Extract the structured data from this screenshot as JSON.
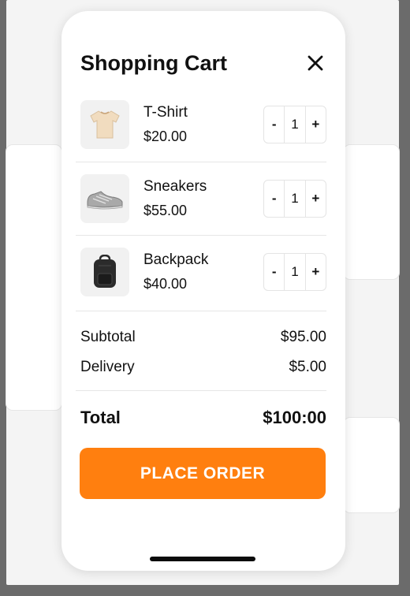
{
  "header": {
    "title": "Shopping Cart"
  },
  "cart": {
    "items": [
      {
        "name": "T-Shirt",
        "price": "$20.00",
        "quantity": "1",
        "image_icon": "tshirt-icon"
      },
      {
        "name": "Sneakers",
        "price": "$55.00",
        "quantity": "1",
        "image_icon": "sneaker-icon"
      },
      {
        "name": "Backpack",
        "price": "$40.00",
        "quantity": "1",
        "image_icon": "backpack-icon"
      }
    ],
    "decrement_label": "-",
    "increment_label": "+"
  },
  "summary": {
    "subtotal_label": "Subtotal",
    "subtotal_value": "$95.00",
    "delivery_label": "Delivery",
    "delivery_value": "$5.00",
    "total_label": "Total",
    "total_value": "$100:00"
  },
  "actions": {
    "place_order_label": "PLACE ORDER"
  },
  "colors": {
    "accent": "#ff7f0f",
    "text": "#111111",
    "thumb_bg": "#f1f1f1"
  }
}
